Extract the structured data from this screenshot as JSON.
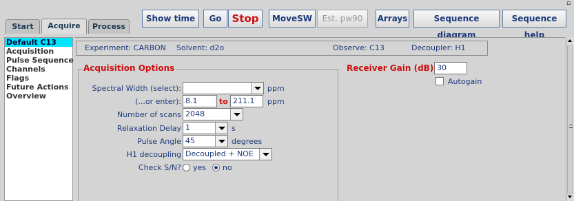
{
  "tabs": [
    {
      "label": "Start",
      "active": false
    },
    {
      "label": "Acquire",
      "active": true
    },
    {
      "label": "Process",
      "active": false
    }
  ],
  "toolbar": {
    "show_time": "Show time",
    "go": "Go",
    "stop": "Stop",
    "movesw": "MoveSW",
    "est_pw90": "Est. pw90",
    "arrays": "Arrays",
    "sequence_diagram": "Sequence diagram",
    "sequence_help": "Sequence help"
  },
  "left_menu": {
    "items": [
      "Default C13",
      "Acquisition",
      "Pulse Sequence",
      "Channels",
      "Flags",
      "Future Actions",
      "Overview"
    ],
    "selected": "Default C13"
  },
  "info_bar": {
    "experiment": "Experiment: CARBON",
    "solvent": "Solvent: d2o",
    "observe": "Observe: C13",
    "decoupler": "Decoupler: H1"
  },
  "acquisition_options": {
    "title": "Acquisition Options",
    "spectral_width_label": "Spectral Width (select):",
    "spectral_width_value": "",
    "spectral_width_unit": "ppm",
    "or_enter_label": "(...or enter):",
    "range_from": "8.1",
    "range_to_label": "to",
    "range_to": "211.1",
    "range_unit": "ppm",
    "scans_label": "Number of scans",
    "scans_value": "2048",
    "relax_label": "Relaxation Delay",
    "relax_value": "1",
    "relax_unit": "s",
    "pulse_label": "Pulse Angle",
    "pulse_value": "45",
    "pulse_unit": "degrees",
    "decoupling_label": "H1 decoupling",
    "decoupling_value": "Decoupled + NOE",
    "check_sn_label": "Check S/N?",
    "check_sn_yes": "yes",
    "check_sn_no": "no",
    "check_sn_selected": "no"
  },
  "receiver_gain": {
    "title": "Receiver Gain (dB)",
    "value": "30",
    "autogain_label": "Autogain",
    "autogain_checked": false
  },
  "colors": {
    "accent_red": "#cc1111",
    "label_blue": "#1d3a7a",
    "selection_cyan": "#00e6ff"
  }
}
